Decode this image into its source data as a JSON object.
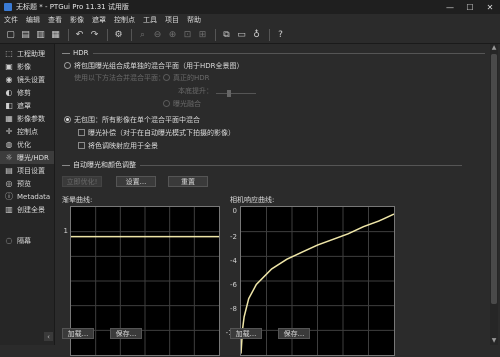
{
  "window": {
    "title": "无标题 * - PTGui Pro 11.31 试用版"
  },
  "menu": [
    "文件",
    "编辑",
    "查看",
    "影像",
    "遮罩",
    "控制点",
    "工具",
    "项目",
    "帮助"
  ],
  "sidebar": {
    "items": [
      {
        "icon": "⬚",
        "label": "工程助理"
      },
      {
        "icon": "▣",
        "label": "影像"
      },
      {
        "icon": "◉",
        "label": "镜头设置"
      },
      {
        "icon": "◐",
        "label": "修剪"
      },
      {
        "icon": "◧",
        "label": "遮罩"
      },
      {
        "icon": "▦",
        "label": "影像参数"
      },
      {
        "icon": "✛",
        "label": "控制点"
      },
      {
        "icon": "◍",
        "label": "优化"
      },
      {
        "icon": "☼",
        "label": "曝光/HDR"
      },
      {
        "icon": "▤",
        "label": "项目设置"
      },
      {
        "icon": "◎",
        "label": "预览"
      },
      {
        "icon": "ⓘ",
        "label": "Metadata"
      },
      {
        "icon": "▥",
        "label": "创建全景"
      },
      {
        "icon": "◌",
        "label": "隔幕"
      }
    ],
    "active_index": 8,
    "collapse_glyph": "‹"
  },
  "hdr": {
    "title": "HDR",
    "opt_link": "将包围曝光组合成单独的混合平面（用于HDR全景图）",
    "opt_link_sub": "使用以下方法合并混合平面：",
    "opt_true_hdr": "真正的HDR",
    "opt_true_hdr_sub": "本底提升：",
    "opt_exposure_fusion": "曝光融合",
    "opt_none": "无包围：所有影像在单个混合平面中混合",
    "chk_exposure_comp": "曝光补偿（对于在自动曝光模式下拍摄的影像）",
    "chk_apply_vignette": "将色调映射应用于全景"
  },
  "auto": {
    "title": "自动曝光和颜色调整",
    "btn_apply": "立即优化!",
    "btn_settings": "设置...",
    "btn_reset": "重置"
  },
  "curves": {
    "vignette_label": "渐晕曲线:",
    "camera_label": "相机响应曲线:",
    "left_ticks": [
      "1"
    ],
    "right_ticks": [
      "0",
      "-2",
      "-4",
      "-6",
      "-8",
      "-10"
    ],
    "btn_load": "加载...",
    "btn_save": "保存..."
  },
  "colors": {
    "curve": "#efe6a8",
    "accent": "#3a7bd5"
  },
  "chart_data": [
    {
      "type": "line",
      "title": "渐晕曲线:",
      "x": [
        0,
        1
      ],
      "y": [
        1,
        1
      ],
      "ylim": [
        0,
        1.25
      ],
      "grid": true
    },
    {
      "type": "line",
      "title": "相机响应曲线:",
      "x": [
        0,
        0.01,
        0.02,
        0.05,
        0.1,
        0.2,
        0.3,
        0.4,
        0.5,
        0.6,
        0.7,
        0.8,
        0.9,
        1.0
      ],
      "y": [
        -9.9,
        -8.2,
        -7.3,
        -6.0,
        -5.0,
        -3.9,
        -3.2,
        -2.7,
        -2.2,
        -1.8,
        -1.4,
        -0.9,
        -0.5,
        0
      ],
      "ylim": [
        -10,
        0.5
      ],
      "grid": true
    }
  ]
}
